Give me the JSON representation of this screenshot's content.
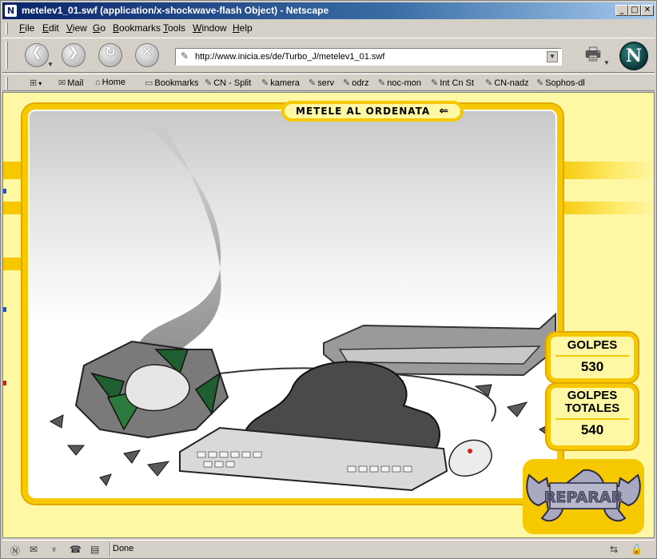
{
  "window": {
    "title": "metelev1_01.swf (application/x-shockwave-flash Object) - Netscape",
    "icon_letter": "N",
    "buttons": {
      "minimize": "_",
      "maximize": "□",
      "close": "✕"
    }
  },
  "menu": [
    {
      "label": "File",
      "u": "F",
      "rest": "ile"
    },
    {
      "label": "Edit",
      "u": "E",
      "rest": "dit"
    },
    {
      "label": "View",
      "u": "V",
      "rest": "iew"
    },
    {
      "label": "Go",
      "u": "G",
      "rest": "o"
    },
    {
      "label": "Bookmarks",
      "u": "B",
      "rest": "ookmarks"
    },
    {
      "label": "Tools",
      "u": "T",
      "rest": "ools"
    },
    {
      "label": "Window",
      "u": "W",
      "rest": "indow"
    },
    {
      "label": "Help",
      "u": "H",
      "rest": "elp"
    }
  ],
  "nav": {
    "back_icon": "back-arrow-icon",
    "forward_icon": "forward-arrow-icon",
    "reload_icon": "reload-icon",
    "stop_icon": "stop-icon",
    "url": "http://www.inicia.es/de/Turbo_J/metelev1_01.swf",
    "logo": "N"
  },
  "personal_toolbar": {
    "items": [
      {
        "label": "Mail"
      },
      {
        "label": "Home"
      },
      {
        "label": "Bookmarks"
      },
      {
        "label": "CN - Split"
      },
      {
        "label": "kamera"
      },
      {
        "label": "serv"
      },
      {
        "label": "odrz"
      },
      {
        "label": "noc-mon"
      },
      {
        "label": "Int Cn St"
      },
      {
        "label": "CN-nadz"
      },
      {
        "label": "Sophos-dl"
      }
    ]
  },
  "game": {
    "title": "METELE AL ORDENATA",
    "title_icon": "undo-arrow-icon",
    "golpes_label": "GOLPES",
    "golpes_value": "530",
    "golpes_totales_label_1": "GOLPES",
    "golpes_totales_label_2": "TOTALES",
    "golpes_totales_value": "540",
    "repair_label": "REPARAR",
    "colors": {
      "yellow": "#f6c800",
      "cream": "#fef7a3"
    }
  },
  "status": {
    "text": "Done"
  }
}
